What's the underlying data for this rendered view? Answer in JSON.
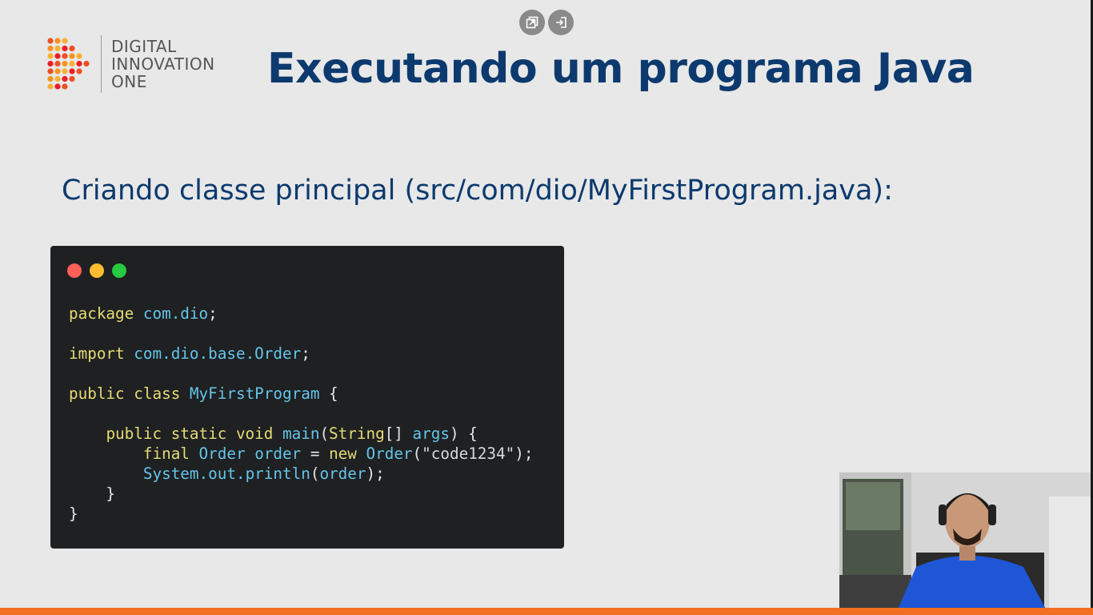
{
  "player_controls": {
    "popout_icon": "popout-icon",
    "exit_icon": "exit-fullscreen-icon"
  },
  "logo": {
    "line1": "DIGITAL",
    "line2": "INNOVATION",
    "line3": "ONE",
    "colors": [
      "#f04e23",
      "#f7941d",
      "#fbb034",
      "#ec1c24"
    ]
  },
  "slide": {
    "title": "Executando um programa Java",
    "subtitle": "Criando classe principal (src/com/dio/MyFirstProgram.java):"
  },
  "code": {
    "lines": [
      [
        [
          "kw",
          "package"
        ],
        [
          "pn",
          " "
        ],
        [
          "id",
          "com.dio"
        ],
        [
          "pn",
          ";"
        ]
      ],
      [],
      [
        [
          "kw",
          "import"
        ],
        [
          "pn",
          " "
        ],
        [
          "id",
          "com.dio.base.Order"
        ],
        [
          "pn",
          ";"
        ]
      ],
      [],
      [
        [
          "kw",
          "public class"
        ],
        [
          "pn",
          " "
        ],
        [
          "id",
          "MyFirstProgram"
        ],
        [
          "pn",
          " {"
        ]
      ],
      [],
      [
        [
          "pn",
          "    "
        ],
        [
          "kw",
          "public static void"
        ],
        [
          "pn",
          " "
        ],
        [
          "id",
          "main"
        ],
        [
          "pn",
          "("
        ],
        [
          "kw",
          "String"
        ],
        [
          "pn",
          "[] "
        ],
        [
          "id",
          "args"
        ],
        [
          "pn",
          ") {"
        ]
      ],
      [
        [
          "pn",
          "        "
        ],
        [
          "kw",
          "final"
        ],
        [
          "pn",
          " "
        ],
        [
          "id",
          "Order"
        ],
        [
          "pn",
          " "
        ],
        [
          "id",
          "order"
        ],
        [
          "pn",
          " = "
        ],
        [
          "kw",
          "new"
        ],
        [
          "pn",
          " "
        ],
        [
          "id",
          "Order"
        ],
        [
          "pn",
          "("
        ],
        [
          "str",
          "\"code1234\""
        ],
        [
          "pn",
          ");"
        ]
      ],
      [
        [
          "pn",
          "        "
        ],
        [
          "id",
          "System.out.println"
        ],
        [
          "pn",
          "("
        ],
        [
          "id",
          "order"
        ],
        [
          "pn",
          ");"
        ]
      ],
      [
        [
          "pn",
          "    }"
        ]
      ],
      [
        [
          "pn",
          "}"
        ]
      ]
    ]
  },
  "colors": {
    "title": "#0d3a6e",
    "accent_bar": "#f36f21",
    "code_bg": "#1e2022",
    "keyword": "#e6db74",
    "identifier": "#66c4e8"
  }
}
